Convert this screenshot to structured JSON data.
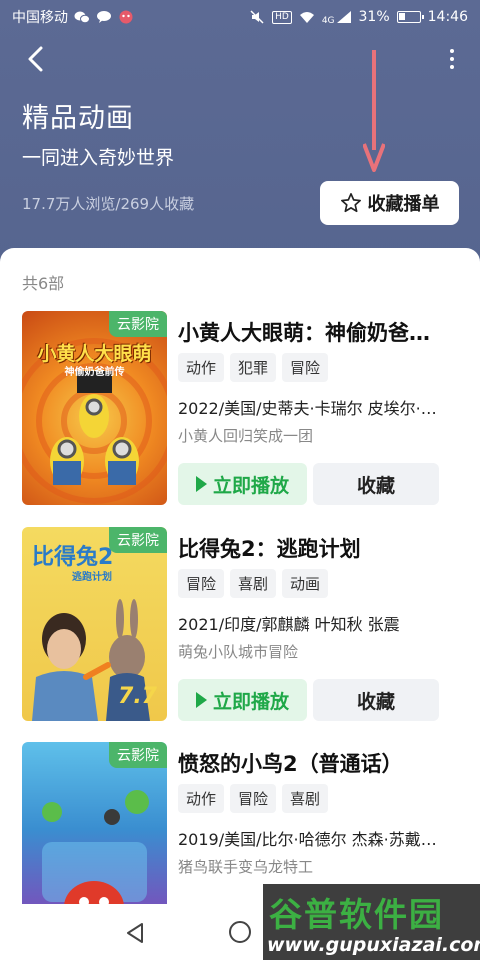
{
  "status_bar": {
    "carrier": "中国移动",
    "signal_text": "4G",
    "battery": "31%",
    "time": "14:46"
  },
  "header": {
    "title": "精品动画",
    "subtitle": "一同进入奇妙世界",
    "stats": "17.7万人浏览/269人收藏",
    "fav_button_label": "收藏播单"
  },
  "list": {
    "count_label": "共6部",
    "play_label": "立即播放",
    "collect_label": "收藏",
    "items": [
      {
        "title": "小黄人大眼萌：神偷奶爸…",
        "badge": "云影院",
        "poster_text": "小黄人大眼萌",
        "poster_sub": "神偷奶爸前传",
        "tags": [
          "动作",
          "犯罪",
          "冒险"
        ],
        "meta": "2022/美国/史蒂夫·卡瑞尔 皮埃尔·…",
        "desc": "小黄人回归笑成一团",
        "rating": "",
        "poster_colors": [
          "#e8641c",
          "#f5a623"
        ]
      },
      {
        "title": "比得兔2：逃跑计划",
        "badge": "云影院",
        "poster_text": "比得兔2",
        "poster_sub": "逃跑计划",
        "tags": [
          "冒险",
          "喜剧",
          "动画"
        ],
        "meta": "2021/印度/郭麒麟 叶知秋 张震",
        "desc": "萌兔小队城市冒险",
        "rating": "7.7",
        "poster_colors": [
          "#f3d65a",
          "#e9b93a"
        ]
      },
      {
        "title": "愤怒的小鸟2（普通话）",
        "badge": "云影院",
        "poster_text": "",
        "poster_sub": "",
        "tags": [
          "动作",
          "冒险",
          "喜剧"
        ],
        "meta": "2019/美国/比尔·哈德尔 杰森·苏戴…",
        "desc": "猪鸟联手变乌龙特工",
        "rating": "",
        "poster_colors": [
          "#2f9fd6",
          "#7b3bb0"
        ]
      }
    ]
  },
  "watermark": {
    "top": "谷普软件园",
    "bottom": "www.gupuxiazai.com"
  },
  "colors": {
    "header_bg": "#5a6892",
    "play_green": "#1fa848",
    "badge_green": "#4cb56a",
    "arrow_red": "#e8727a"
  }
}
